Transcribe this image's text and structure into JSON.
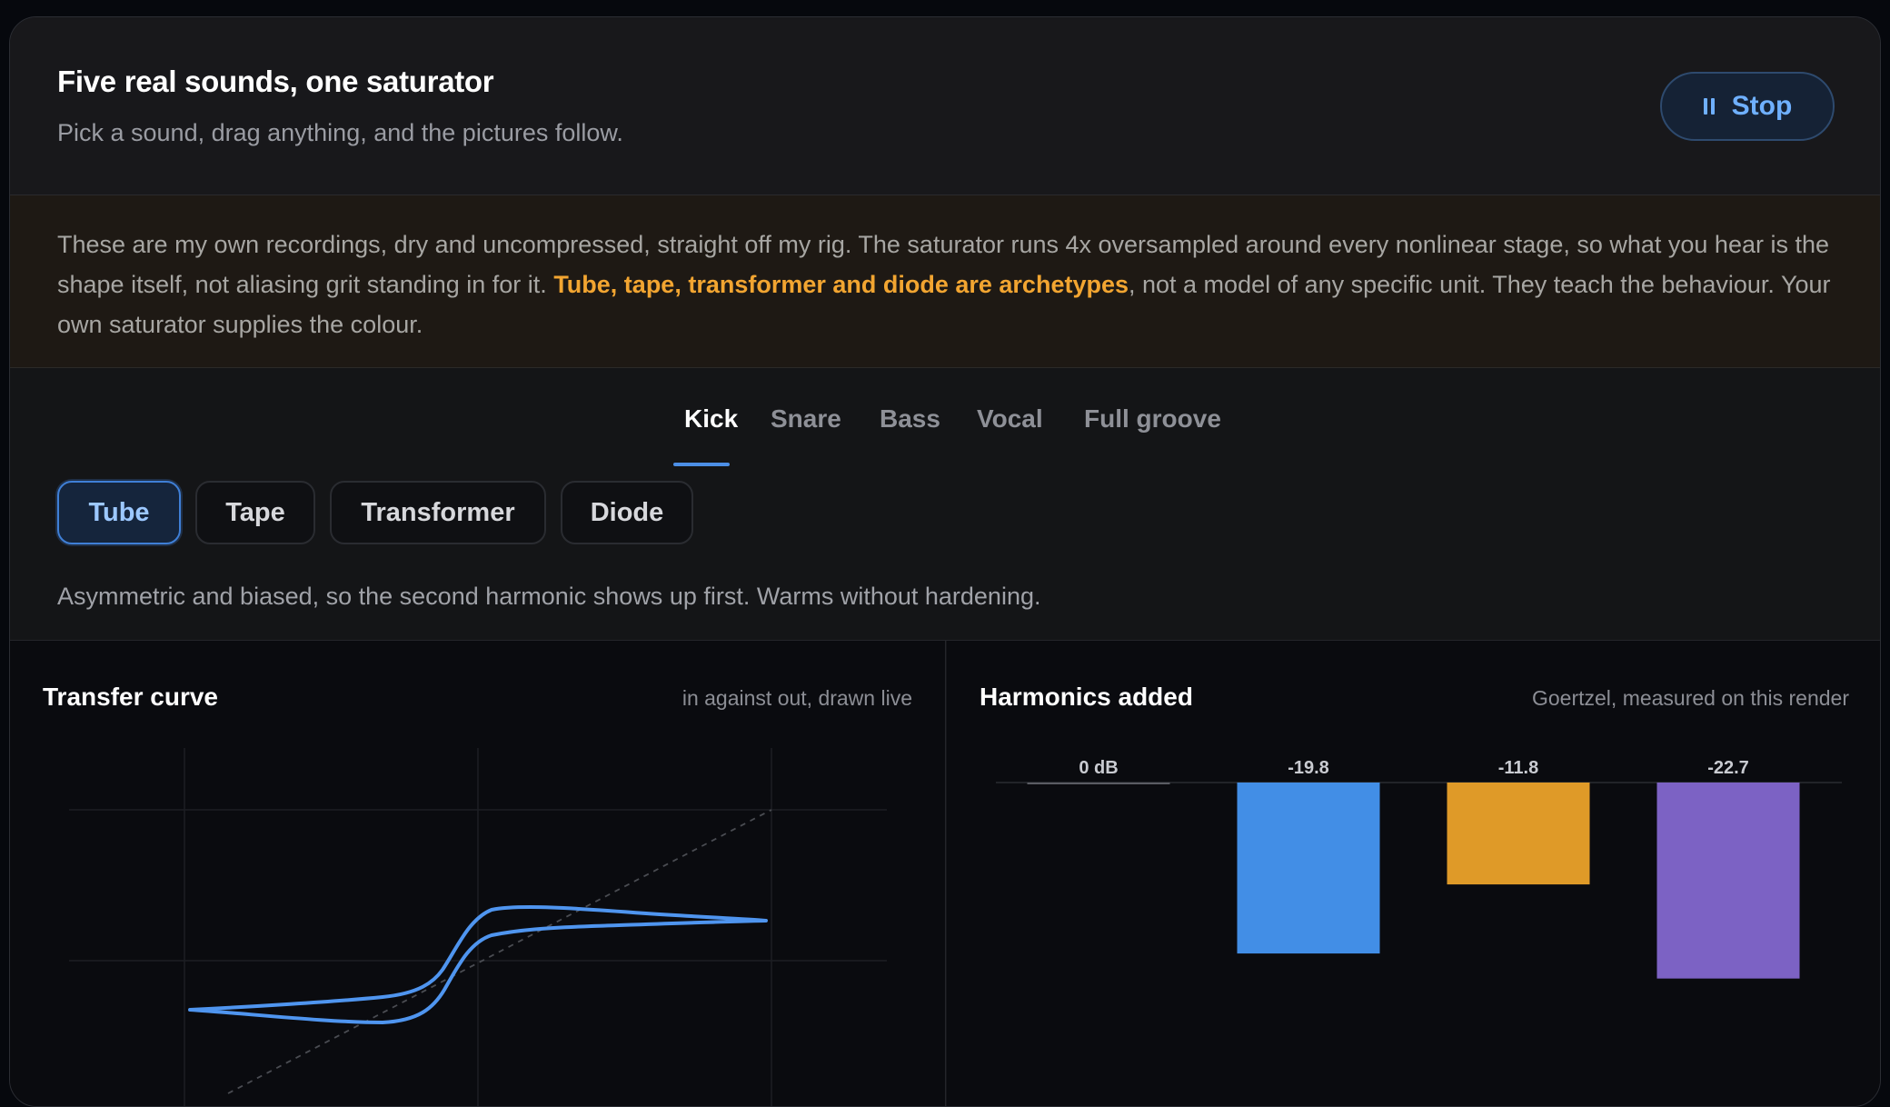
{
  "header": {
    "title": "Five real sounds, one saturator",
    "subtitle": "Pick a sound, drag anything, and the pictures follow.",
    "stop_label": "Stop"
  },
  "note": {
    "part1": "These are my own recordings, dry and uncompressed, straight off my rig. The saturator runs 4x oversampled around every nonlinear stage, so what you hear is the shape itself, not aliasing grit standing in for it. ",
    "highlight": "Tube, tape, transformer and diode are archetypes",
    "part2": ", not a model of any specific unit. They teach the behaviour. Your own saturator supplies the colour."
  },
  "tabs": [
    {
      "label": "Kick",
      "active": true
    },
    {
      "label": "Snare",
      "active": false
    },
    {
      "label": "Bass",
      "active": false
    },
    {
      "label": "Vocal",
      "active": false
    },
    {
      "label": "Full groove",
      "active": false
    }
  ],
  "modes": [
    {
      "label": "Tube",
      "active": true
    },
    {
      "label": "Tape",
      "active": false
    },
    {
      "label": "Transformer",
      "active": false
    },
    {
      "label": "Diode",
      "active": false
    }
  ],
  "mode_description": "Asymmetric and biased, so the second harmonic shows up first. Warms without hardening.",
  "transfer_panel": {
    "title": "Transfer curve",
    "note": "in against out, drawn live",
    "curve_color": "#4f95ef"
  },
  "harmonics_panel": {
    "title": "Harmonics added",
    "note": "Goertzel, measured on this render"
  },
  "chart_data": {
    "type": "bar",
    "title": "Harmonics added",
    "baseline_label": "0 dB",
    "values": [
      0,
      -19.8,
      -11.8,
      -22.7
    ],
    "labels": [
      "0 dB",
      "-19.8",
      "-11.8",
      "-22.7"
    ],
    "colors": [
      "#5a5c63",
      "#428ee6",
      "#df9a28",
      "#7c62c4"
    ],
    "ylim": [
      -30,
      0
    ]
  },
  "colors": {
    "accent": "#4c8fe6",
    "highlight": "#f2a531"
  }
}
